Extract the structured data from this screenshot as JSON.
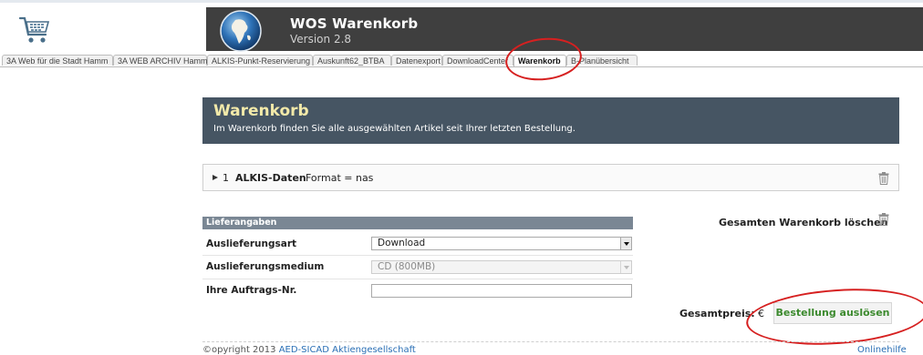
{
  "app": {
    "title": "WOS Warenkorb",
    "version": "Version 2.8"
  },
  "tabs": [
    {
      "label": "3A Web für die Stadt Hamm"
    },
    {
      "label": "3A WEB ARCHIV Hamm"
    },
    {
      "label": "ALKIS-Punkt-Reservierung"
    },
    {
      "label": "Auskunft62_BTBA"
    },
    {
      "label": "Datenexport"
    },
    {
      "label": "DownloadCenter"
    },
    {
      "label": "Warenkorb",
      "active": true
    },
    {
      "label": "B-Planübersicht"
    }
  ],
  "cart": {
    "title": "Warenkorb",
    "subtitle": "Im Warenkorb finden Sie alle ausgewählten Artikel seit Ihrer letzten Bestellung."
  },
  "item": {
    "number": "1",
    "name": "ALKIS-Daten",
    "format": "Format = nas"
  },
  "delivery": {
    "header": "Lieferangaben",
    "type_label": "Auslieferungsart",
    "type_value": "Download",
    "medium_label": "Auslieferungsmedium",
    "medium_value": "CD (800MB)",
    "order_no_label": "Ihre Auftrags-Nr.",
    "order_no_value": ""
  },
  "actions": {
    "clear_cart": "Gesamten Warenkorb löschen",
    "total_label": "Gesamtpreis:",
    "total_currency": "€",
    "order_button": "Bestellung auslösen"
  },
  "footer": {
    "copyright_prefix": "©opyright 2013 ",
    "copyright_link": "AED-SICAD Aktiengesellschaft",
    "help": "Onlinehilfe"
  },
  "colors": {
    "header_bar": "#3f3f3f",
    "cart_header": "#465563",
    "cart_title": "#f2e9a9",
    "table_header": "#7a8794",
    "order_button_text": "#3c8a2e",
    "annotation": "#d62020"
  },
  "icons": [
    "cart-icon",
    "globe-icon",
    "expand-arrow-icon",
    "trash-icon"
  ]
}
